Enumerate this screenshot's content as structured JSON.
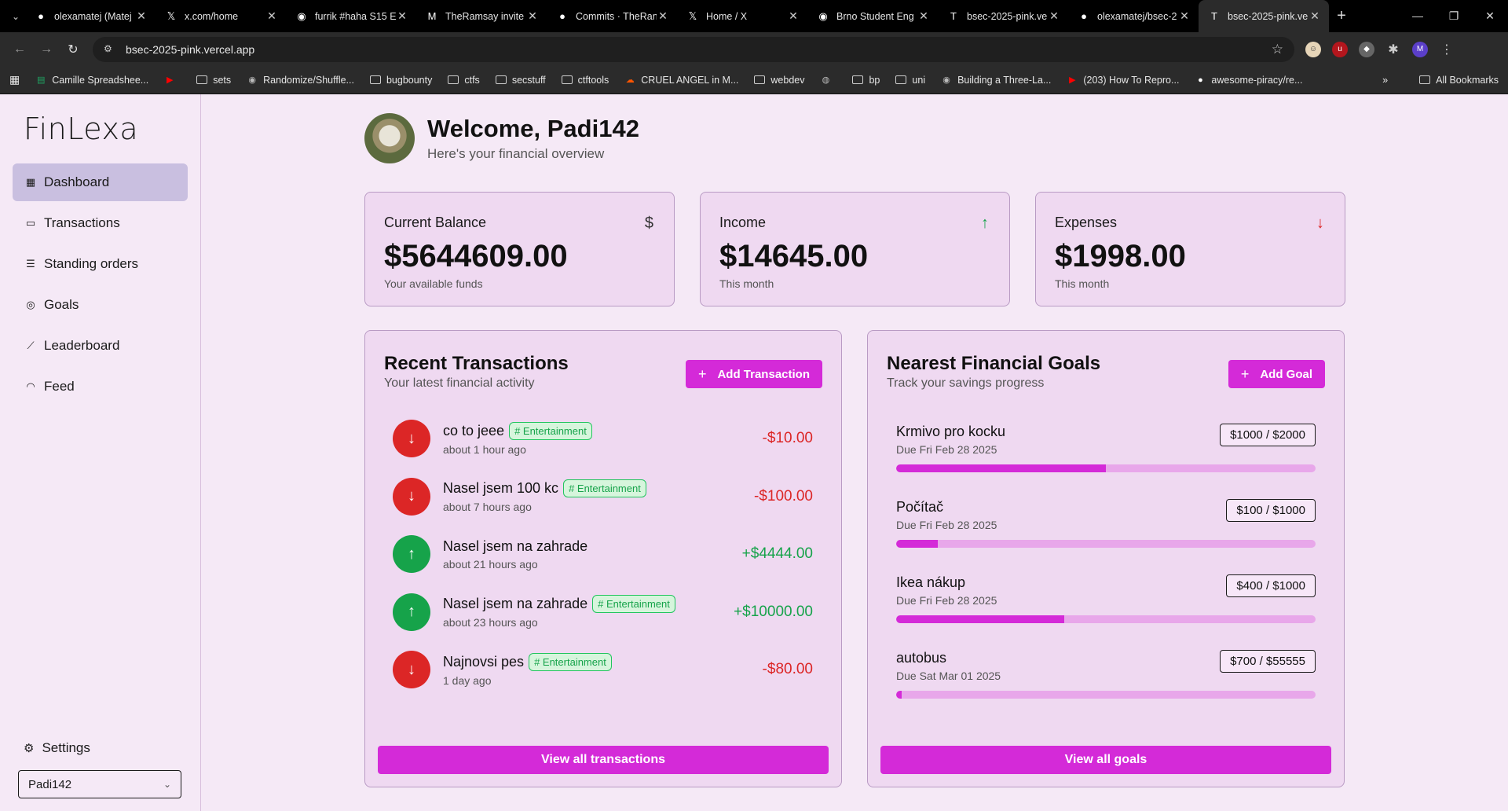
{
  "browser": {
    "tabs": [
      {
        "title": "olexamatej (Matej",
        "icon": "github-icon",
        "active": false
      },
      {
        "title": "x.com/home",
        "icon": "x-icon",
        "active": false
      },
      {
        "title": "furrik #haha S15 E",
        "icon": "site-icon",
        "active": false
      },
      {
        "title": "TheRamsay invite",
        "icon": "gmail-icon",
        "active": false
      },
      {
        "title": "Commits · TheRan",
        "icon": "github-icon",
        "active": false
      },
      {
        "title": "Home / X",
        "icon": "x-icon",
        "active": false
      },
      {
        "title": "Brno Student Eng",
        "icon": "site-icon",
        "active": false
      },
      {
        "title": "bsec-2025-pink.ve",
        "icon": "t3-icon",
        "active": false
      },
      {
        "title": "olexamatej/bsec-2",
        "icon": "github-icon",
        "active": false
      },
      {
        "title": "bsec-2025-pink.ve",
        "icon": "t3-icon",
        "active": true
      }
    ],
    "url": "bsec-2025-pink.vercel.app",
    "bookmarks": [
      {
        "label": "Camille Spreadshee...",
        "icon": "sheets-icon"
      },
      {
        "label": "",
        "icon": "youtube-icon"
      },
      {
        "label": "sets",
        "icon": "folder-icon"
      },
      {
        "label": "Randomize/Shuffle...",
        "icon": "site-icon"
      },
      {
        "label": "bugbounty",
        "icon": "folder-icon"
      },
      {
        "label": "ctfs",
        "icon": "folder-icon"
      },
      {
        "label": "secstuff",
        "icon": "folder-icon"
      },
      {
        "label": "ctftools",
        "icon": "folder-icon"
      },
      {
        "label": "CRUEL ANGEL in M...",
        "icon": "soundcloud-icon"
      },
      {
        "label": "webdev",
        "icon": "folder-icon"
      },
      {
        "label": "",
        "icon": "globe-icon"
      },
      {
        "label": "bp",
        "icon": "folder-icon"
      },
      {
        "label": "uni",
        "icon": "folder-icon"
      },
      {
        "label": "Building a Three-La...",
        "icon": "site-icon"
      },
      {
        "label": "(203) How To Repro...",
        "icon": "youtube-icon"
      },
      {
        "label": "awesome-piracy/re...",
        "icon": "github-icon"
      }
    ],
    "all_bookmarks": "All Bookmarks",
    "profile_initial": "M"
  },
  "app": {
    "logo": "FinLexa",
    "nav": [
      {
        "label": "Dashboard",
        "icon": "dashboard-icon",
        "active": true
      },
      {
        "label": "Transactions",
        "icon": "card-icon",
        "active": false
      },
      {
        "label": "Standing orders",
        "icon": "list-icon",
        "active": false
      },
      {
        "label": "Goals",
        "icon": "target-icon",
        "active": false
      },
      {
        "label": "Leaderboard",
        "icon": "chart-icon",
        "active": false
      },
      {
        "label": "Feed",
        "icon": "rss-icon",
        "active": false
      }
    ],
    "settings_label": "Settings",
    "user_select": "Padi142"
  },
  "header": {
    "title": "Welcome, Padi142",
    "subtitle": "Here's your financial overview"
  },
  "stats": [
    {
      "label": "Current Balance",
      "value": "$5644609.00",
      "sub": "Your available funds",
      "icon": "dollar-icon",
      "icon_color": "#333333"
    },
    {
      "label": "Income",
      "value": "$14645.00",
      "sub": "This month",
      "icon": "arrow-up-icon",
      "icon_color": "#16a34a"
    },
    {
      "label": "Expenses",
      "value": "$1998.00",
      "sub": "This month",
      "icon": "arrow-down-icon",
      "icon_color": "#dc2626"
    }
  ],
  "transactions": {
    "title": "Recent Transactions",
    "subtitle": "Your latest financial activity",
    "add_label": "Add Transaction",
    "view_all": "View all transactions",
    "items": [
      {
        "title": "co to jeee",
        "tag": "# Entertainment",
        "time": "about 1 hour ago",
        "amount": "-$10.00",
        "direction": "down"
      },
      {
        "title": "Nasel jsem 100 kc",
        "tag": "# Entertainment",
        "time": "about 7 hours ago",
        "amount": "-$100.00",
        "direction": "down"
      },
      {
        "title": "Nasel jsem na zahrade",
        "tag": "",
        "time": "about 21 hours ago",
        "amount": "+$4444.00",
        "direction": "up"
      },
      {
        "title": "Nasel jsem na zahrade",
        "tag": "# Entertainment",
        "time": "about 23 hours ago",
        "amount": "+$10000.00",
        "direction": "up"
      },
      {
        "title": "Najnovsi pes",
        "tag": "# Entertainment",
        "time": "1 day ago",
        "amount": "-$80.00",
        "direction": "down"
      }
    ]
  },
  "goals": {
    "title": "Nearest Financial Goals",
    "subtitle": "Track your savings progress",
    "add_label": "Add Goal",
    "view_all": "View all goals",
    "items": [
      {
        "name": "Krmivo pro kocku",
        "due": "Due Fri Feb 28 2025",
        "badge": "$1000 / $2000",
        "progress": 0.5
      },
      {
        "name": "Počítač",
        "due": "Due Fri Feb 28 2025",
        "badge": "$100 / $1000",
        "progress": 0.1
      },
      {
        "name": "Ikea nákup",
        "due": "Due Fri Feb 28 2025",
        "badge": "$400 / $1000",
        "progress": 0.4
      },
      {
        "name": "autobus",
        "due": "Due Sat Mar 01 2025",
        "badge": "$700 / $55555",
        "progress": 0.0126
      }
    ]
  },
  "colors": {
    "accent": "#d42ad8",
    "positive": "#16a34a",
    "negative": "#dc2626"
  }
}
